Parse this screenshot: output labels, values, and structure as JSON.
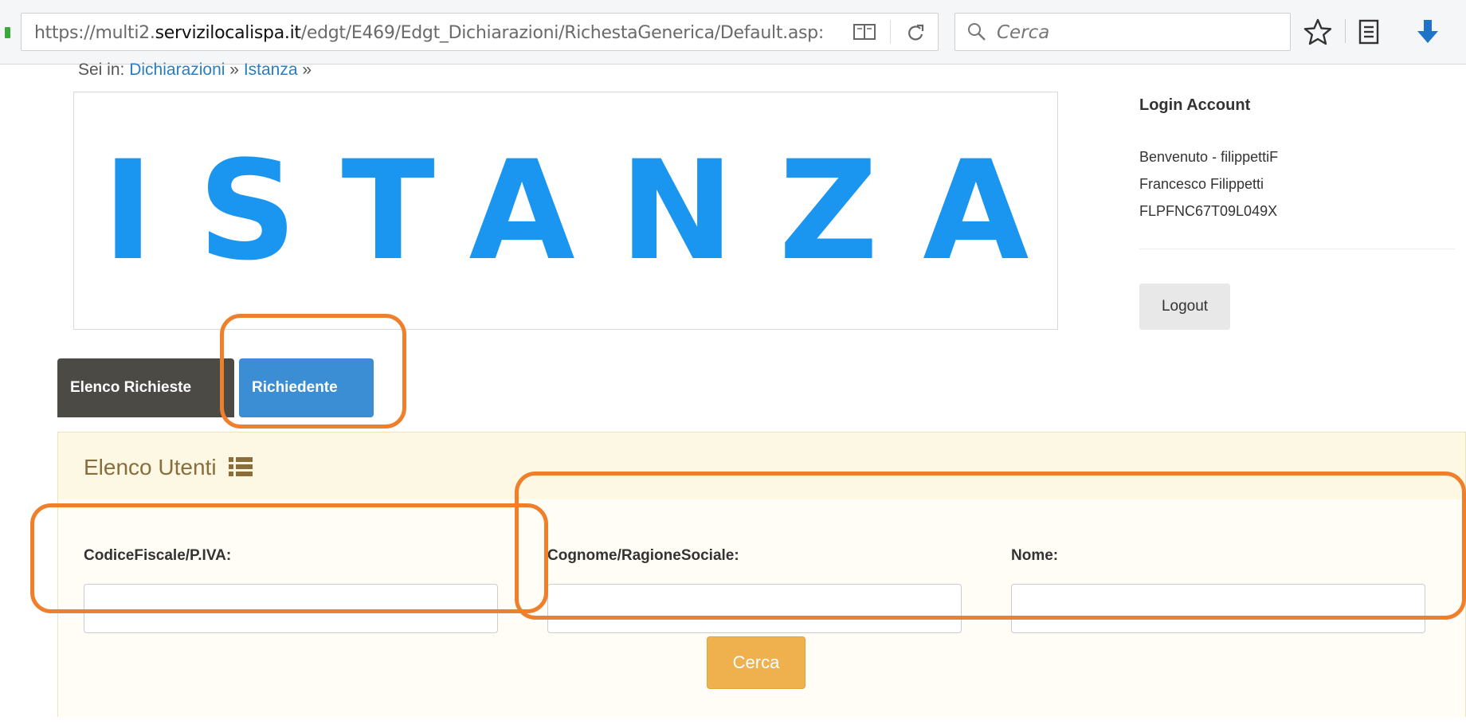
{
  "browser": {
    "url_prefix": "https://multi2.",
    "url_domain": "servizilocalispa.it",
    "url_path": "/edgt/E469/Edgt_Dichiarazioni/RichestaGenerica/Default.asp:",
    "search_placeholder": "Cerca"
  },
  "breadcrumb": {
    "prefix": "Sei in:",
    "link1": "Dichiarazioni",
    "sep1": "»",
    "link2": "Istanza",
    "sep2": "»"
  },
  "banner": {
    "text": "ISTANZA"
  },
  "login": {
    "title": "Login Account",
    "welcome": "Benvenuto - filippettiF",
    "full_name": "Francesco Filippetti",
    "fiscal_code": "FLPFNC67T09L049X",
    "logout_label": "Logout"
  },
  "tabs": [
    {
      "label": "Elenco Richieste"
    },
    {
      "label": "Richiedente"
    }
  ],
  "panel": {
    "title": "Elenco Utenti",
    "fields": [
      {
        "label": "CodiceFiscale/P.IVA:",
        "value": ""
      },
      {
        "label": "Cognome/RagioneSociale:",
        "value": ""
      },
      {
        "label": "Nome:",
        "value": ""
      }
    ],
    "search_button": "Cerca"
  },
  "colors": {
    "banner_text": "#1a95f0",
    "tab_active": "#3b8ed3",
    "tab_inactive": "#4b4a45",
    "panel_header": "#fcf8e3",
    "search_button": "#efb04e",
    "annotation": "#f07f2b"
  },
  "icons": [
    "lock-icon",
    "reader-view-icon",
    "reload-icon",
    "magnifier-icon",
    "star-icon",
    "reading-list-icon",
    "download-arrow-icon",
    "list-icon"
  ]
}
